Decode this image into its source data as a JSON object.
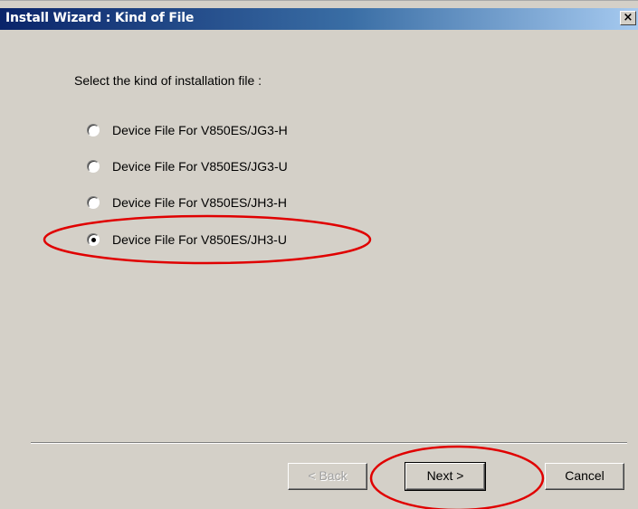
{
  "window": {
    "title": "Install Wizard : Kind of File",
    "close_glyph": "✕"
  },
  "content": {
    "prompt": "Select the kind of installation file :",
    "options": [
      {
        "label": "Device File For V850ES/JG3-H",
        "selected": false
      },
      {
        "label": "Device File For V850ES/JG3-U",
        "selected": false
      },
      {
        "label": "Device File For V850ES/JH3-H",
        "selected": false
      },
      {
        "label": "Device File For V850ES/JH3-U",
        "selected": true
      }
    ]
  },
  "buttons": {
    "back": {
      "label": "< Back",
      "enabled": false
    },
    "next": {
      "label": "Next >",
      "enabled": true
    },
    "cancel": {
      "label": "Cancel",
      "enabled": true
    }
  },
  "annotations": {
    "highlight_color": "#e00000",
    "highlighted": [
      "option 4",
      "Next >"
    ]
  },
  "colors": {
    "dialog_face": "#d4d0c8",
    "titlebar_start": "#0a246a",
    "titlebar_end": "#a6caf0"
  }
}
